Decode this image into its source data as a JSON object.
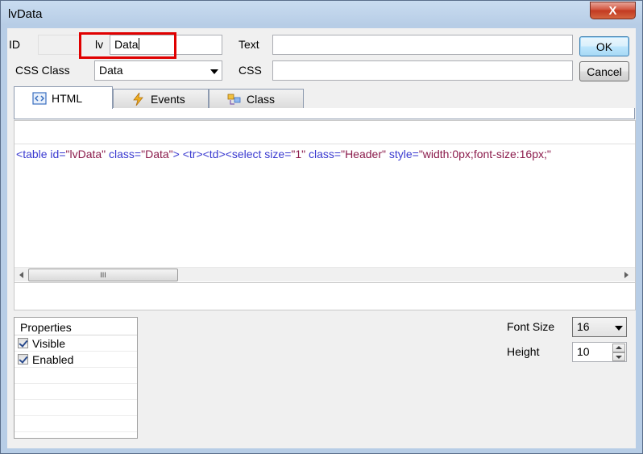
{
  "window": {
    "title": "lvData",
    "close_label": "X"
  },
  "form": {
    "id_label": "ID",
    "id_prefix": "lv",
    "id_value": "Data",
    "text_label": "Text",
    "text_value": "",
    "css_class_label": "CSS Class",
    "css_class_value": "Data",
    "css_label": "CSS",
    "css_value": ""
  },
  "buttons": {
    "ok": "OK",
    "cancel": "Cancel"
  },
  "tabs": [
    {
      "label": "HTML",
      "icon": "html-code-icon",
      "active": true
    },
    {
      "label": "Events",
      "icon": "lightning-icon",
      "active": false
    },
    {
      "label": "Class",
      "icon": "class-icon",
      "active": false
    }
  ],
  "code": {
    "p1": "<",
    "tag1": "table",
    "a1": " id=",
    "v1": "\"lvData\"",
    "a2": " class=",
    "v2": "\"Data\"",
    "p2": ">  <",
    "tag2": "tr",
    "p3": "><",
    "tag3": "td",
    "p4": "><",
    "tag4": "select",
    "a3": " size=",
    "v3": "\"1\"",
    "a4": " class=",
    "v4": "\"Header\"",
    "a5": " style=",
    "v5": "\"width:0px;font-size:16px;\""
  },
  "scrollbar": {
    "grip": "III"
  },
  "properties": {
    "header": "Properties",
    "items": [
      {
        "label": "Visible",
        "checked": true
      },
      {
        "label": "Enabled",
        "checked": true
      }
    ]
  },
  "font_size": {
    "label": "Font Size",
    "value": "16"
  },
  "height": {
    "label": "Height",
    "value": "10"
  },
  "colors": {
    "highlight": "#e00000",
    "tag": "#3a3ad0",
    "value": "#8b1b4b"
  }
}
